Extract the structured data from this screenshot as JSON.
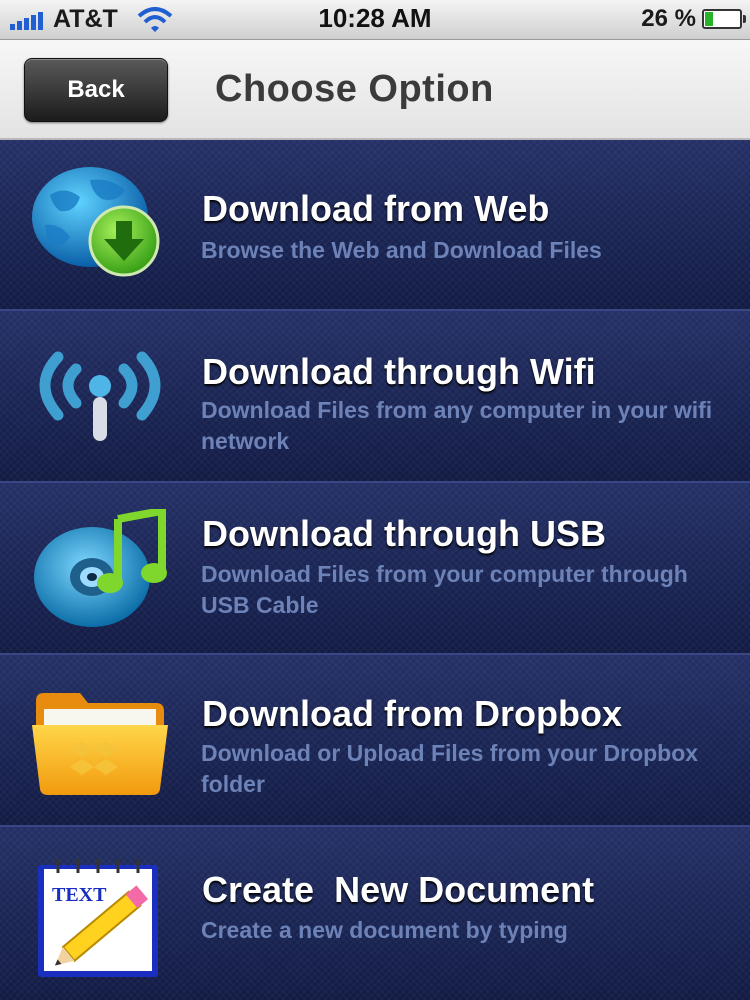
{
  "status_bar": {
    "carrier": "AT&T",
    "time": "10:28 AM",
    "battery_percent": "26 %",
    "battery_level": 0.26
  },
  "nav": {
    "back_label": "Back",
    "title": "Choose Option"
  },
  "options": [
    {
      "title": "Download from Web",
      "description": "Browse the Web and Download Files",
      "icon": "globe-download-icon"
    },
    {
      "title": "Download through Wifi",
      "description": "Download Files from any computer in your wifi network",
      "icon": "wifi-antenna-icon"
    },
    {
      "title": "Download through USB",
      "description": "Download Files from your computer through USB Cable",
      "icon": "music-disc-icon"
    },
    {
      "title": "Download from Dropbox",
      "description": "Download or Upload Files from your Dropbox folder",
      "icon": "dropbox-folder-icon"
    },
    {
      "title": "Create  New Document",
      "description": "Create a new document by typing",
      "icon": "text-notepad-icon",
      "icon_label": "TEXT"
    }
  ]
}
